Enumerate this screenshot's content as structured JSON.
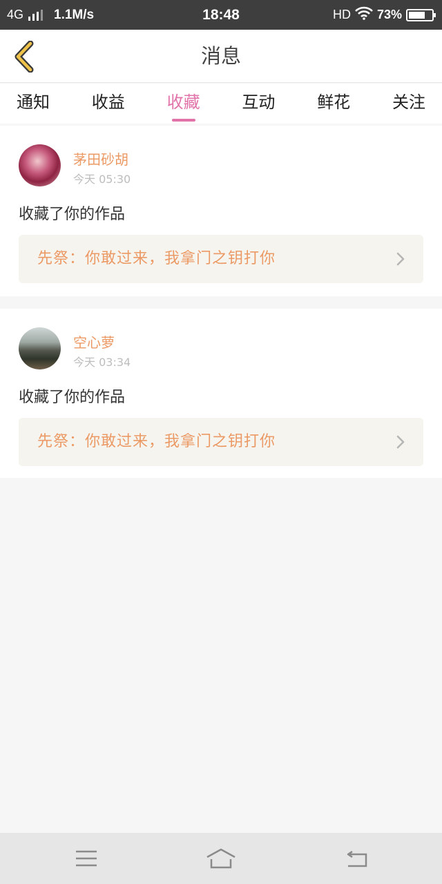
{
  "status_bar": {
    "network": "4G",
    "speed": "1.1M/s",
    "time": "18:48",
    "hd": "HD",
    "battery": "73%",
    "battery_level": 0.73
  },
  "header": {
    "title": "消息"
  },
  "tabs": [
    {
      "label": "通知",
      "active": false
    },
    {
      "label": "收益",
      "active": false
    },
    {
      "label": "收藏",
      "active": true
    },
    {
      "label": "互动",
      "active": false
    },
    {
      "label": "鲜花",
      "active": false
    },
    {
      "label": "关注",
      "active": false
    }
  ],
  "messages": [
    {
      "user": "茅田砂胡",
      "time": "今天 05:30",
      "action": "收藏了你的作品",
      "work": "先祭：你敢过来，我拿门之钥打你"
    },
    {
      "user": "空心萝",
      "time": "今天 03:34",
      "action": "收藏了你的作品",
      "work": "先祭：你敢过来，我拿门之钥打你"
    }
  ],
  "colors": {
    "accent": "#e273a9",
    "name": "#ec9a65",
    "status_bar": "#3e3e3e",
    "back_icon": "#efc34a"
  },
  "icons": [
    "back-arrow-icon",
    "chevron-right-icon",
    "menu-icon",
    "home-icon",
    "return-icon",
    "wifi-icon",
    "battery-icon",
    "signal-icon"
  ]
}
